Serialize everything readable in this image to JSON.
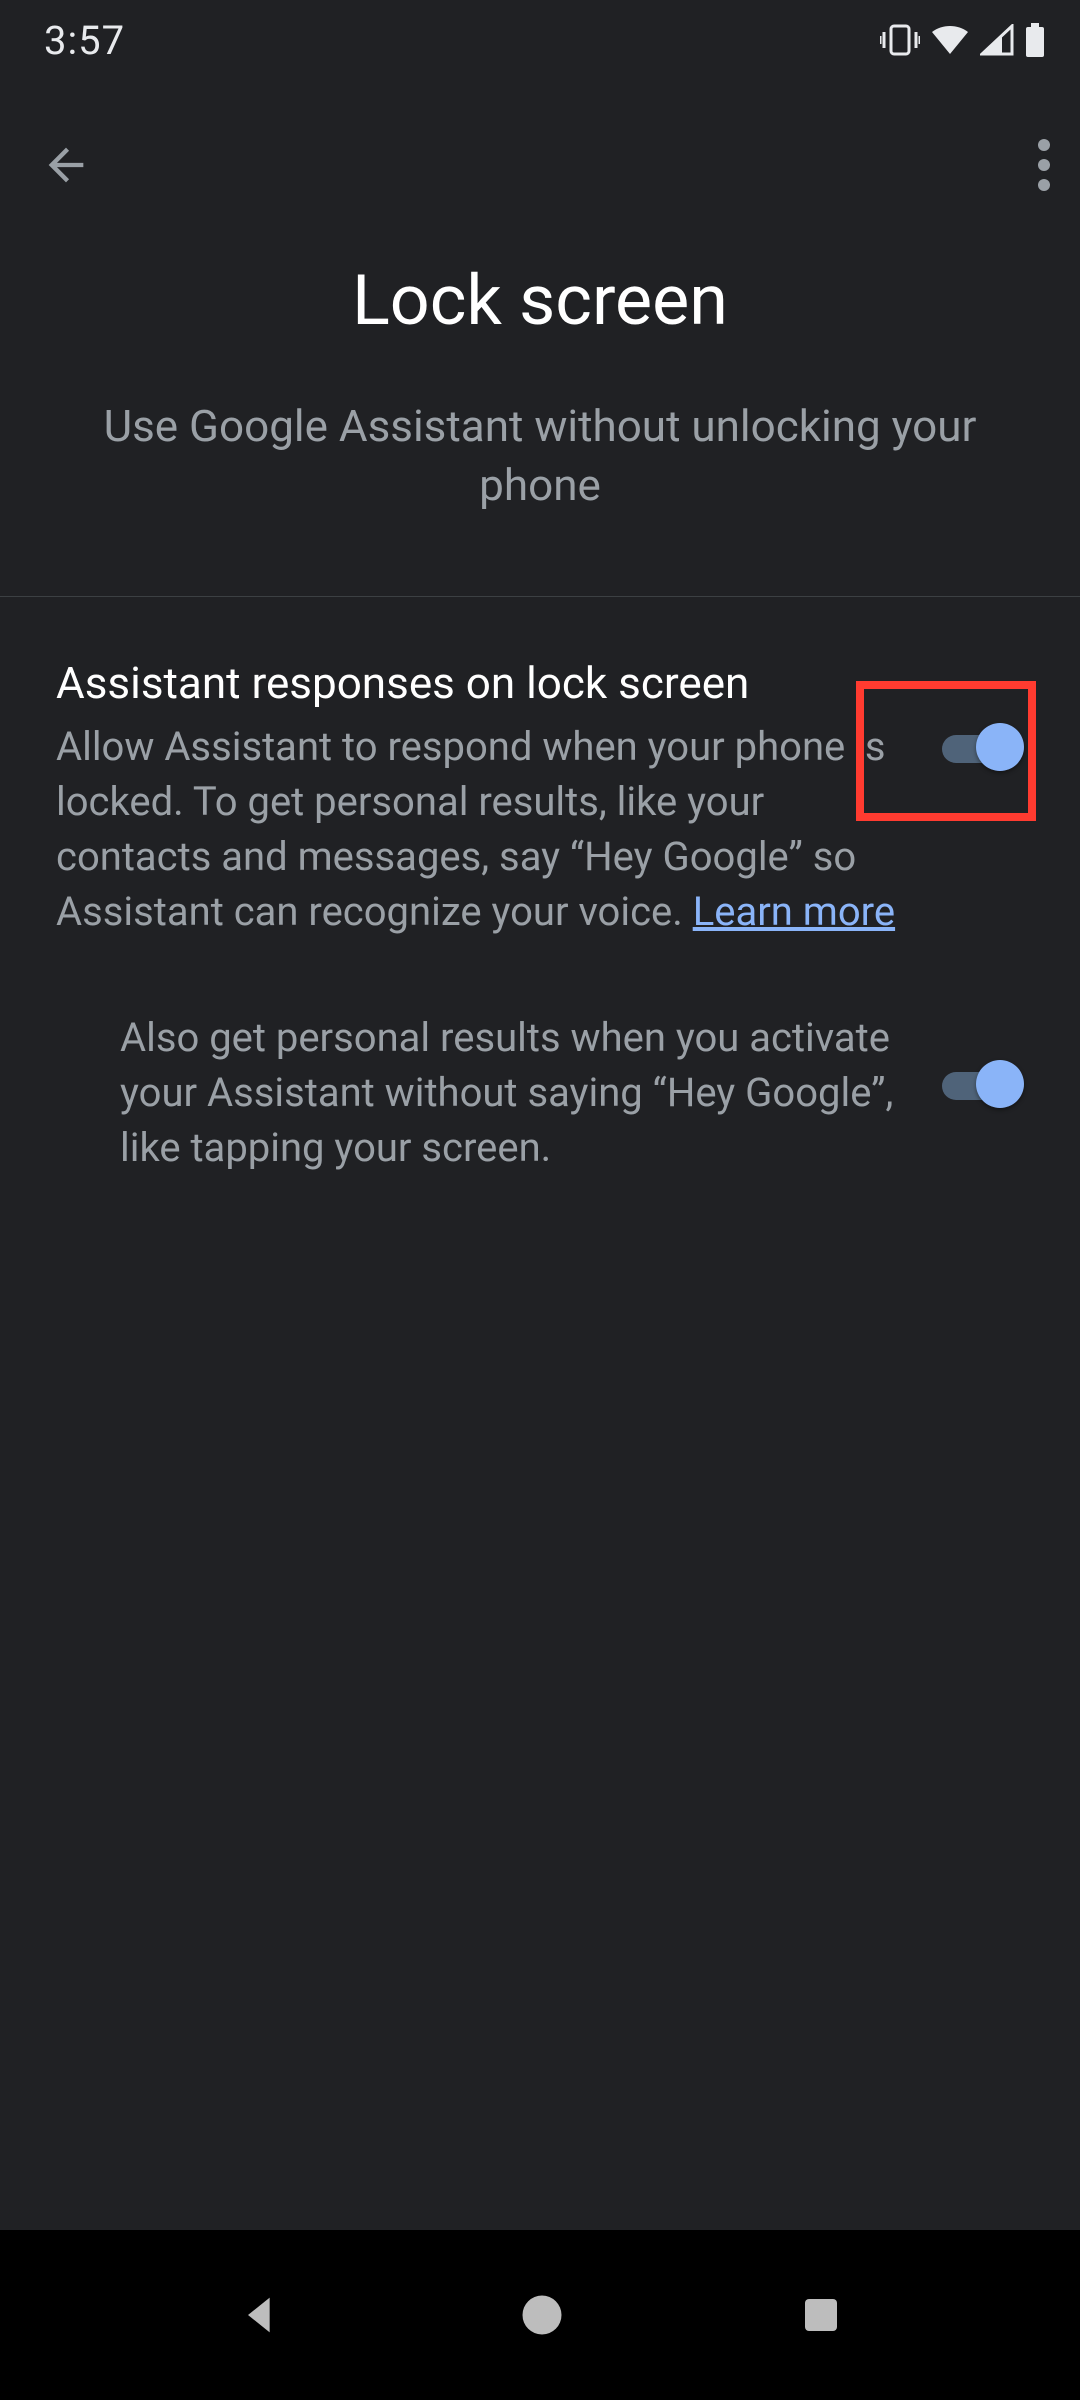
{
  "status_bar": {
    "time": "3:57"
  },
  "header": {
    "title": "Lock screen",
    "subtitle": "Use Google Assistant without unlocking your phone"
  },
  "settings": {
    "row1": {
      "title": "Assistant responses on lock screen",
      "description_prefix": "Allow Assistant to respond when your phone is locked. To get personal results, like your contacts and messages, say “Hey Google” so Assistant can recognize your voice. ",
      "learn_more": "Learn more",
      "toggle_on": true,
      "highlighted": true
    },
    "row2": {
      "description": "Also get personal results when you activate your Assistant without saying “Hey Google”, like tapping your screen.",
      "toggle_on": true
    }
  }
}
